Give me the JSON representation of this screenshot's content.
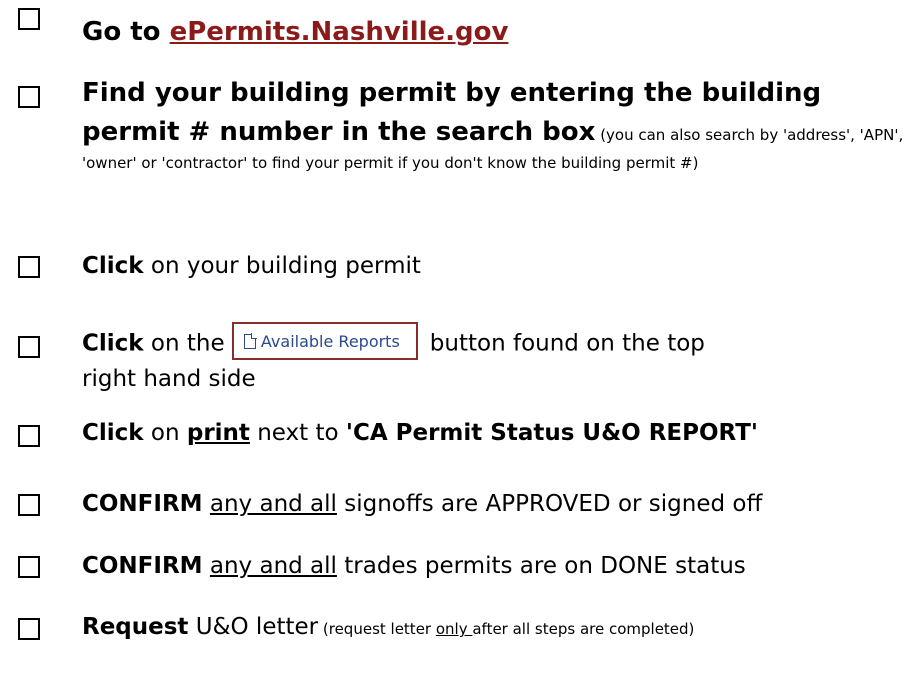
{
  "items": [
    {
      "lead": "Go to ",
      "link": "ePermits.Nashville.gov"
    },
    {
      "line1": "Find your building permit by entering the building",
      "line2_bold": "permit # number in the search box",
      "note": " (you can also search by 'address', 'APN', 'owner' or 'contractor' to find your permit if you don't know the building permit #)"
    },
    {
      "bold": "Click",
      "rest": " on your building permit"
    },
    {
      "bold": "Click",
      "mid": " on the ",
      "button_label": "Available Reports",
      "rest": "button found on the top right hand side"
    },
    {
      "bold": "Click",
      "mid": " on ",
      "underline_bold": "print",
      "mid2": " next to ",
      "quoted_bold": "'CA Permit Status U&O REPORT'"
    },
    {
      "bold": "CONFIRM",
      "underline": "any and all",
      "rest": " signoffs are APPROVED or signed off"
    },
    {
      "bold": "CONFIRM",
      "underline": "any and all",
      "rest": " trades permits are on DONE status"
    },
    {
      "bold": "Request",
      "rest": " U&O letter",
      "note_pre": " (request letter ",
      "note_underline": "only ",
      "note_post": "after all steps are completed)"
    }
  ]
}
